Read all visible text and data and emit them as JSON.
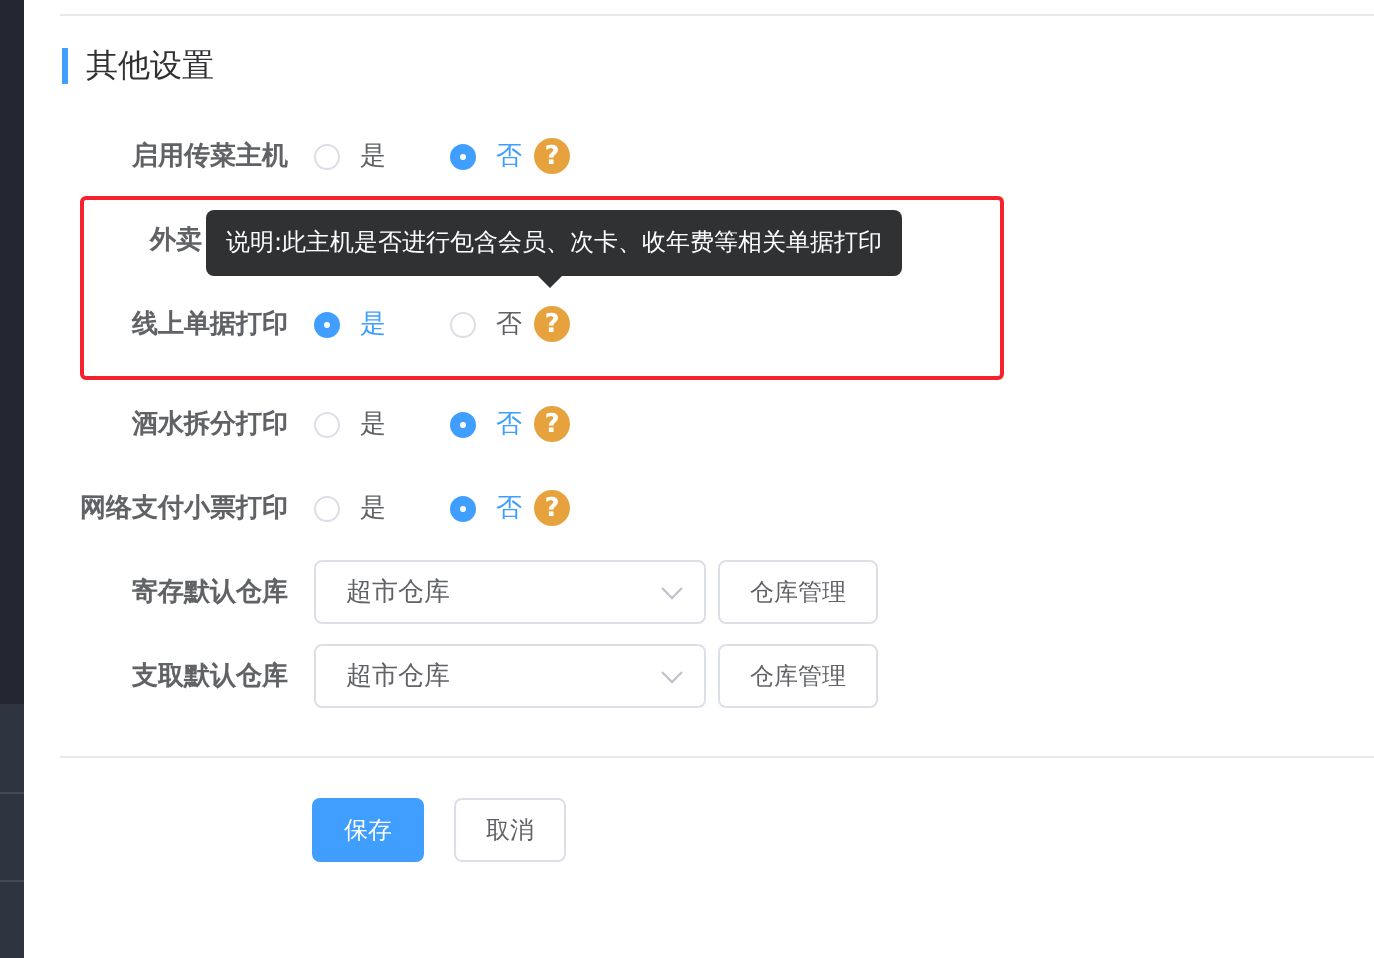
{
  "section": {
    "title": "其他设置"
  },
  "items": [
    {
      "kind": "radio",
      "label": "启用传菜主机",
      "options": [
        {
          "label": "是",
          "selected": false
        },
        {
          "label": "否",
          "selected": true
        }
      ],
      "help": "?"
    },
    {
      "kind": "highlight",
      "tooltip": "说明:此主机是否进行包含会员、次卡、收年费等相关单据打印",
      "rows": [
        {
          "kind": "label",
          "label": "外卖"
        },
        {
          "kind": "radio",
          "label": "线上单据打印",
          "options": [
            {
              "label": "是",
              "selected": true
            },
            {
              "label": "否",
              "selected": false
            }
          ],
          "help": "?"
        }
      ]
    },
    {
      "kind": "radio",
      "label": "酒水拆分打印",
      "options": [
        {
          "label": "是",
          "selected": false
        },
        {
          "label": "否",
          "selected": true
        }
      ],
      "help": "?"
    },
    {
      "kind": "radio",
      "label": "网络支付小票打印",
      "options": [
        {
          "label": "是",
          "selected": false
        },
        {
          "label": "否",
          "selected": true
        }
      ],
      "help": "?"
    },
    {
      "kind": "select",
      "label": "寄存默认仓库",
      "value": "超市仓库",
      "button": "仓库管理"
    },
    {
      "kind": "select",
      "label": "支取默认仓库",
      "value": "超市仓库",
      "button": "仓库管理"
    }
  ],
  "buttons": [
    {
      "label": "保存",
      "kind": "primary"
    },
    {
      "label": "取消",
      "kind": "default"
    }
  ]
}
